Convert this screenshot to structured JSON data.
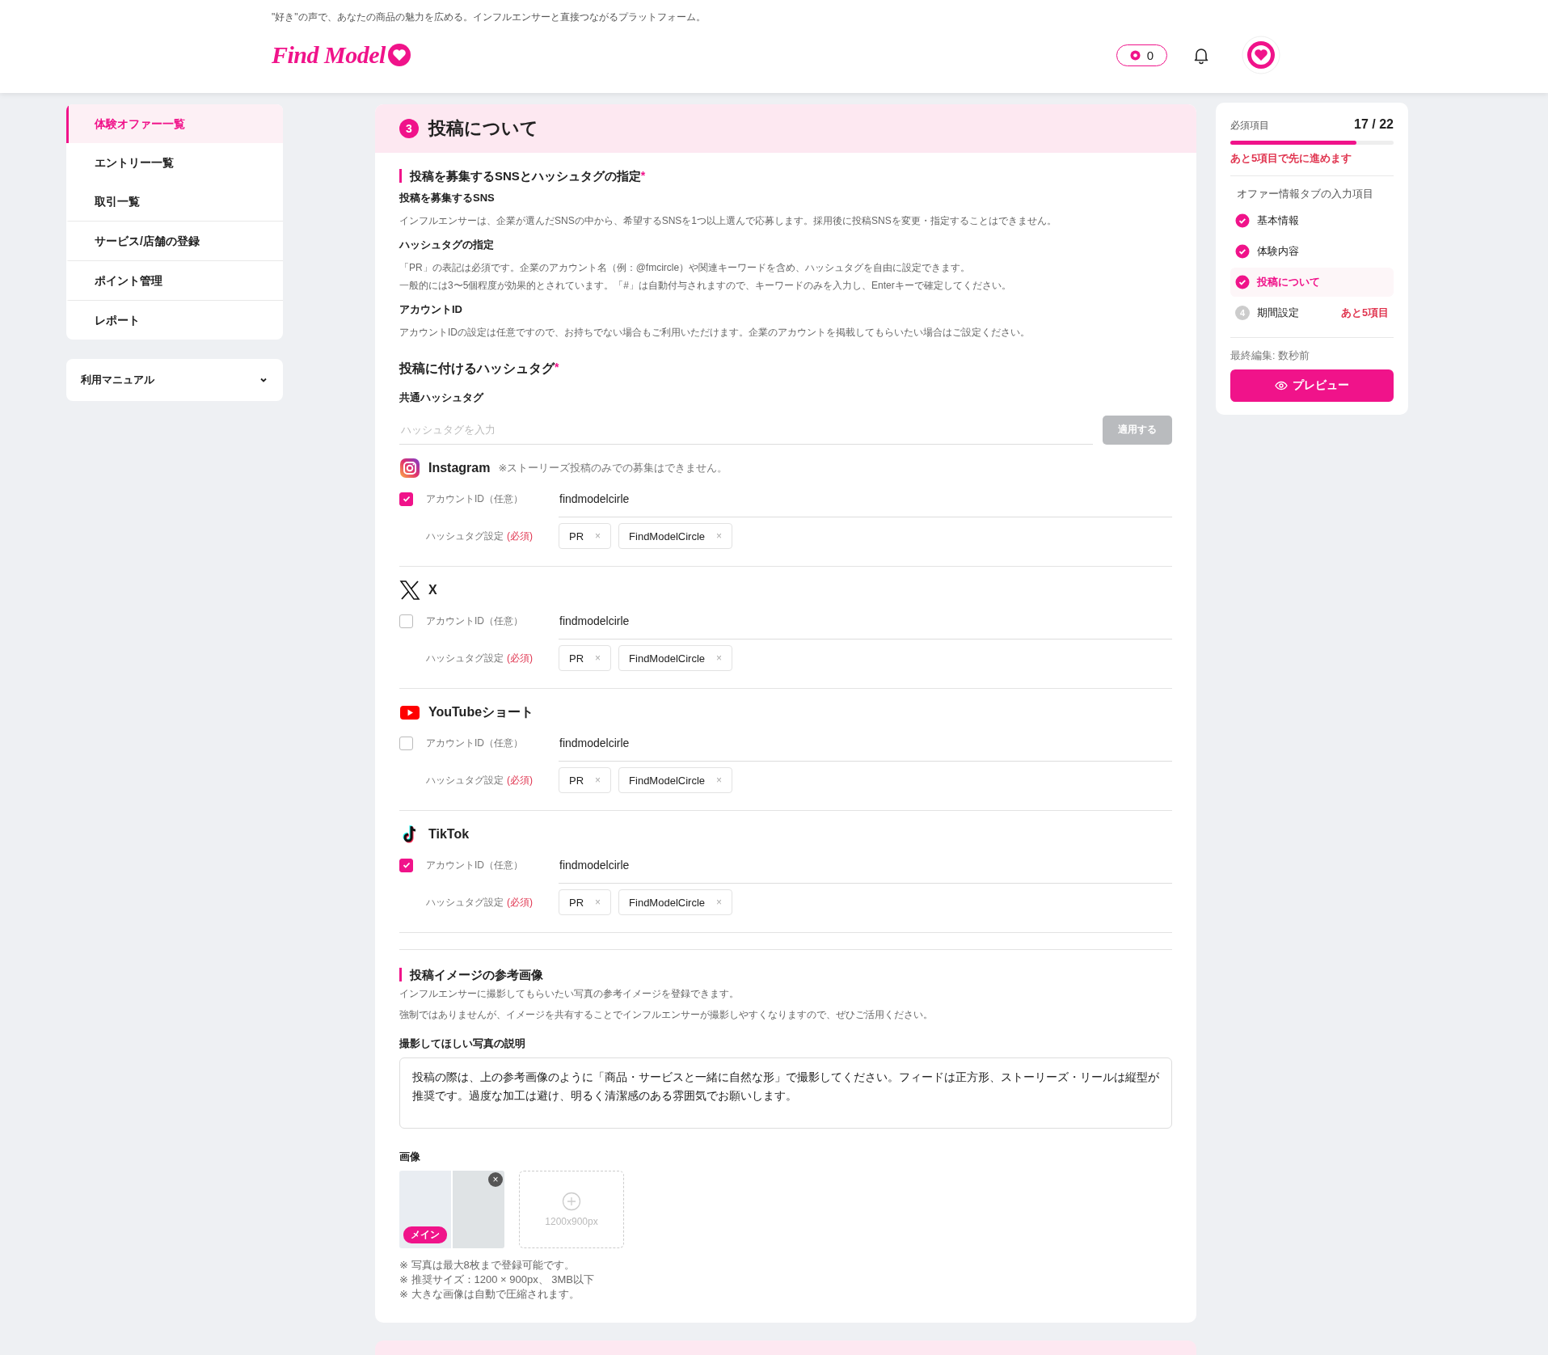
{
  "header": {
    "tagline": "\"好き\"の声で、あなたの商品の魅力を広める。インフルエンサーと直接つながるプラットフォーム。",
    "logo": "Find Model",
    "points": "0"
  },
  "sidebar": {
    "items": [
      {
        "label": "体験オファー一覧",
        "selected": true
      },
      {
        "label": "エントリー一覧",
        "selected": false
      },
      {
        "label": "取引一覧",
        "selected": false
      },
      {
        "label": "サービス/店舗の登録",
        "selected": false
      },
      {
        "label": "ポイント管理",
        "selected": false
      },
      {
        "label": "レポート",
        "selected": false
      }
    ],
    "manual": "利用マニュアル"
  },
  "main": {
    "step": "3",
    "title": "投稿について",
    "sns_section": {
      "heading": "投稿を募集するSNSとハッシュタグの指定",
      "required_mark": "*",
      "blocks": [
        {
          "title": "投稿を募集するSNS",
          "lines": [
            "インフルエンサーは、企業が選んだSNSの中から、希望するSNSを1つ以上選んで応募します。採用後に投稿SNSを変更・指定することはできません。"
          ]
        },
        {
          "title": "ハッシュタグの指定",
          "lines": [
            "「PR」の表記は必須です。企業のアカウント名（例：@fmcircle）や関連キーワードを含め、ハッシュタグを自由に設定できます。",
            "一般的には3〜5個程度が効果的とされています。「#」は自動付与されますので、キーワードのみを入力し、Enterキーで確定してください。"
          ]
        },
        {
          "title": "アカウントID",
          "lines": [
            "アカウントIDの設定は任意ですので、お持ちでない場合もご利用いただけます。企業のアカウントを掲載してもらいたい場合はご設定ください。"
          ]
        }
      ]
    },
    "hashtags": {
      "heading": "投稿に付けるハッシュタグ",
      "required_mark": "*",
      "common_label": "共通ハッシュタグ",
      "placeholder": "ハッシュタグを入力",
      "apply": "適用する",
      "apply_disabled": true
    },
    "sns": [
      {
        "kind": "instagram",
        "name": "Instagram",
        "note": "※ストーリーズ投稿のみでの募集はできません。",
        "checked": true,
        "account_label": "アカウントID（任意）",
        "account": "findmodelcirle",
        "tag_label": "ハッシュタグ設定",
        "tag_required": "(必須)",
        "tags": [
          {
            "label": "PR",
            "remove": "×"
          },
          {
            "label": "FindModelCircle",
            "remove": "×"
          }
        ]
      },
      {
        "kind": "x",
        "name": "X",
        "checked": false,
        "account_label": "アカウントID（任意）",
        "account": "findmodelcirle",
        "tag_label": "ハッシュタグ設定",
        "tag_required": "(必須)",
        "tags": [
          {
            "label": "PR",
            "remove": "×"
          },
          {
            "label": "FindModelCircle",
            "remove": "×"
          }
        ]
      },
      {
        "kind": "youtube",
        "name": "YouTubeショート",
        "checked": false,
        "account_label": "アカウントID（任意）",
        "account": "findmodelcirle",
        "tag_label": "ハッシュタグ設定",
        "tag_required": "(必須)",
        "tags": [
          {
            "label": "PR",
            "remove": "×"
          },
          {
            "label": "FindModelCircle",
            "remove": "×"
          }
        ]
      },
      {
        "kind": "tiktok",
        "name": "TikTok",
        "checked": true,
        "account_label": "アカウントID（任意）",
        "account": "findmodelcirle",
        "tag_label": "ハッシュタグ設定",
        "tag_required": "(必須)",
        "tags": [
          {
            "label": "PR",
            "remove": "×"
          },
          {
            "label": "FindModelCircle",
            "remove": "×"
          }
        ]
      }
    ],
    "reference": {
      "heading": "投稿イメージの参考画像",
      "lines": [
        "インフルエンサーに撮影してもらいたい写真の参考イメージを登録できます。",
        "強制ではありませんが、イメージを共有することでインフルエンサーが撮影しやすくなりますので、ぜひご活用ください。"
      ],
      "desc_label": "撮影してほしい写真の説明",
      "desc_value": "投稿の際は、上の参考画像のように「商品・サービスと一緒に自然な形」で撮影してください。フィードは正方形、ストーリーズ・リールは縦型が推奨です。過度な加工は避け、明るく清潔感のある雰囲気でお願いします。",
      "images_label": "画像",
      "images": [
        {
          "badge": "メイン",
          "remove": "×"
        }
      ],
      "upload_hint": "1200x900px",
      "notes": [
        "※  写真は最大8枚まで登録可能です。",
        "※  推奨サイズ：1200 × 900px、 3MB以下",
        "※  大きな画像は自動で圧縮されます。"
      ]
    }
  },
  "progress": {
    "label": "必須項目",
    "count": "17 / 22",
    "level": 0.77,
    "remaining": "あと5項目で先に進めます",
    "group": "オファー情報タブの入力項目",
    "steps": [
      {
        "label": "基本情報",
        "kind": "done",
        "selected": false
      },
      {
        "label": "体験内容",
        "kind": "done",
        "selected": false
      },
      {
        "label": "投稿について",
        "kind": "done",
        "selected": true
      },
      {
        "label": "期間設定",
        "kind": "pending",
        "number": "4",
        "selected": false,
        "note": "あと5項目"
      }
    ],
    "last_edit": "最終編集: 数秒前",
    "preview": "プレビュー"
  }
}
